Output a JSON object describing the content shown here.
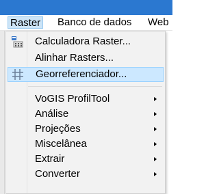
{
  "menubar": {
    "items": [
      {
        "label": "Raster",
        "active": true
      },
      {
        "label": "Banco de dados",
        "active": false
      },
      {
        "label": "Web",
        "active": false
      }
    ]
  },
  "dropdown": {
    "items": [
      {
        "label": "Calculadora Raster...",
        "icon": "calculator-icon",
        "submenu": false,
        "highlighted": false
      },
      {
        "label": "Alinhar Rasters...",
        "icon": "",
        "submenu": false,
        "highlighted": false
      },
      {
        "label": "Georreferenciador...",
        "icon": "georeferencer-grid-icon",
        "submenu": false,
        "highlighted": true
      },
      {
        "label": "VoGIS ProfilTool",
        "icon": "",
        "submenu": true,
        "highlighted": false
      },
      {
        "label": "Análise",
        "icon": "",
        "submenu": true,
        "highlighted": false
      },
      {
        "label": "Projeções",
        "icon": "",
        "submenu": true,
        "highlighted": false
      },
      {
        "label": "Miscelânea",
        "icon": "",
        "submenu": true,
        "highlighted": false
      },
      {
        "label": "Extrair",
        "icon": "",
        "submenu": true,
        "highlighted": false
      },
      {
        "label": "Converter",
        "icon": "",
        "submenu": true,
        "highlighted": false
      }
    ]
  },
  "colors": {
    "titlebar": "#2b78d0",
    "highlight": "#cce8ff",
    "highlight_border": "#99d1ff",
    "menu_background": "#f2f2f2"
  }
}
